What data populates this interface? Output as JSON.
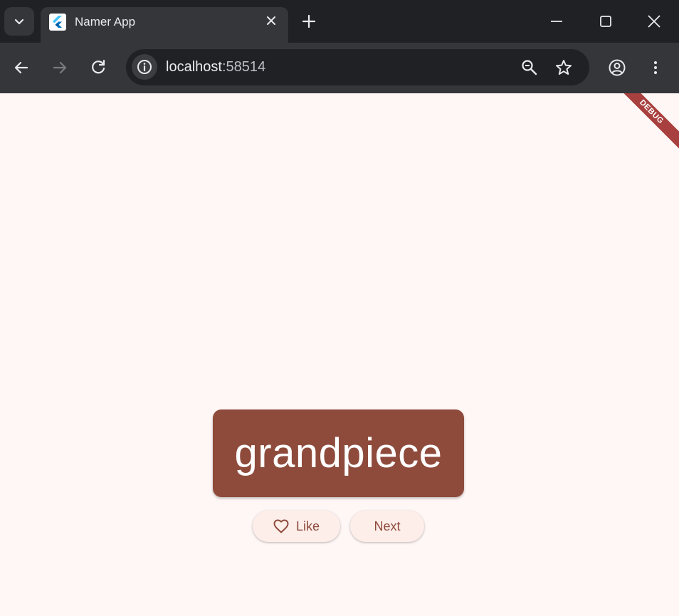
{
  "browser": {
    "tab": {
      "title": "Namer App",
      "favicon": "flutter-icon"
    },
    "url": {
      "host": "localhost",
      "port": ":58514"
    },
    "icons": [
      "tab-search-icon",
      "close-icon",
      "new-tab-icon",
      "minimize-icon",
      "maximize-icon",
      "window-close-icon",
      "back-icon",
      "forward-icon",
      "reload-icon",
      "site-info-icon",
      "zoom-icon",
      "bookmark-star-icon",
      "profile-icon",
      "menu-icon"
    ]
  },
  "app": {
    "debug_banner": "DEBUG",
    "word": "grandpiece",
    "like_button": {
      "label": "Like",
      "icon": "heart-outline-icon"
    },
    "next_button": {
      "label": "Next"
    }
  },
  "colors": {
    "background": "#fff7f5",
    "primary": "#8e4b3c",
    "button_bg": "#fdeeea",
    "debug_banner": "#a8403f"
  }
}
